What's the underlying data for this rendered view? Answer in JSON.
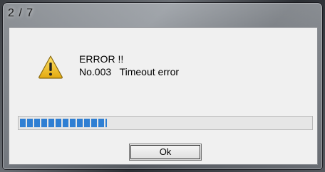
{
  "window": {
    "title": "2 / 7"
  },
  "message": {
    "heading": "ERROR !!",
    "detail": "No.003   Timeout error",
    "icon": "warning-icon"
  },
  "progress": {
    "fraction": 0.3
  },
  "buttons": {
    "ok_label": "Ok"
  },
  "colors": {
    "progress_fill": "#2f7fd3",
    "warning_yellow": "#f3c425"
  }
}
